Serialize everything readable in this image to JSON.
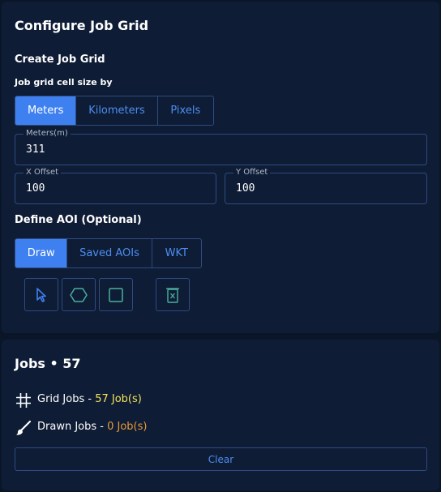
{
  "config": {
    "title": "Configure Job Grid",
    "create_heading": "Create Job Grid",
    "cell_size_label": "Job grid cell size by",
    "unit_options": [
      "Meters",
      "Kilometers",
      "Pixels"
    ],
    "selected_unit": "Meters",
    "meters_field": {
      "label": "Meters(m)",
      "value": "311"
    },
    "x_offset": {
      "label": "X Offset",
      "value": "100"
    },
    "y_offset": {
      "label": "Y Offset",
      "value": "100"
    },
    "aoi_heading": "Define AOI (Optional)",
    "aoi_tabs": [
      "Draw",
      "Saved AOIs",
      "WKT"
    ],
    "selected_aoi_tab": "Draw",
    "draw_tools": [
      "select-pointer-icon",
      "polygon-hexagon-icon",
      "rectangle-icon",
      "delete-shapes-icon"
    ]
  },
  "jobs": {
    "title": "Jobs • 57",
    "grid_jobs": {
      "label": "Grid Jobs",
      "separator": " - ",
      "count": "57 Job(s)",
      "icon": "grid-icon"
    },
    "drawn_jobs": {
      "label": "Drawn Jobs",
      "separator": " - ",
      "count": "0 Job(s)",
      "icon": "brush-icon"
    },
    "clear_label": "Clear"
  },
  "colors": {
    "background": "#0a1628",
    "panel": "#0e1c35",
    "accent": "#3f80f0",
    "border": "#2d4c80",
    "grid_count": "#f5e45a",
    "drawn_count": "#e69a3a",
    "tool_icon": "#4ab0a0"
  }
}
